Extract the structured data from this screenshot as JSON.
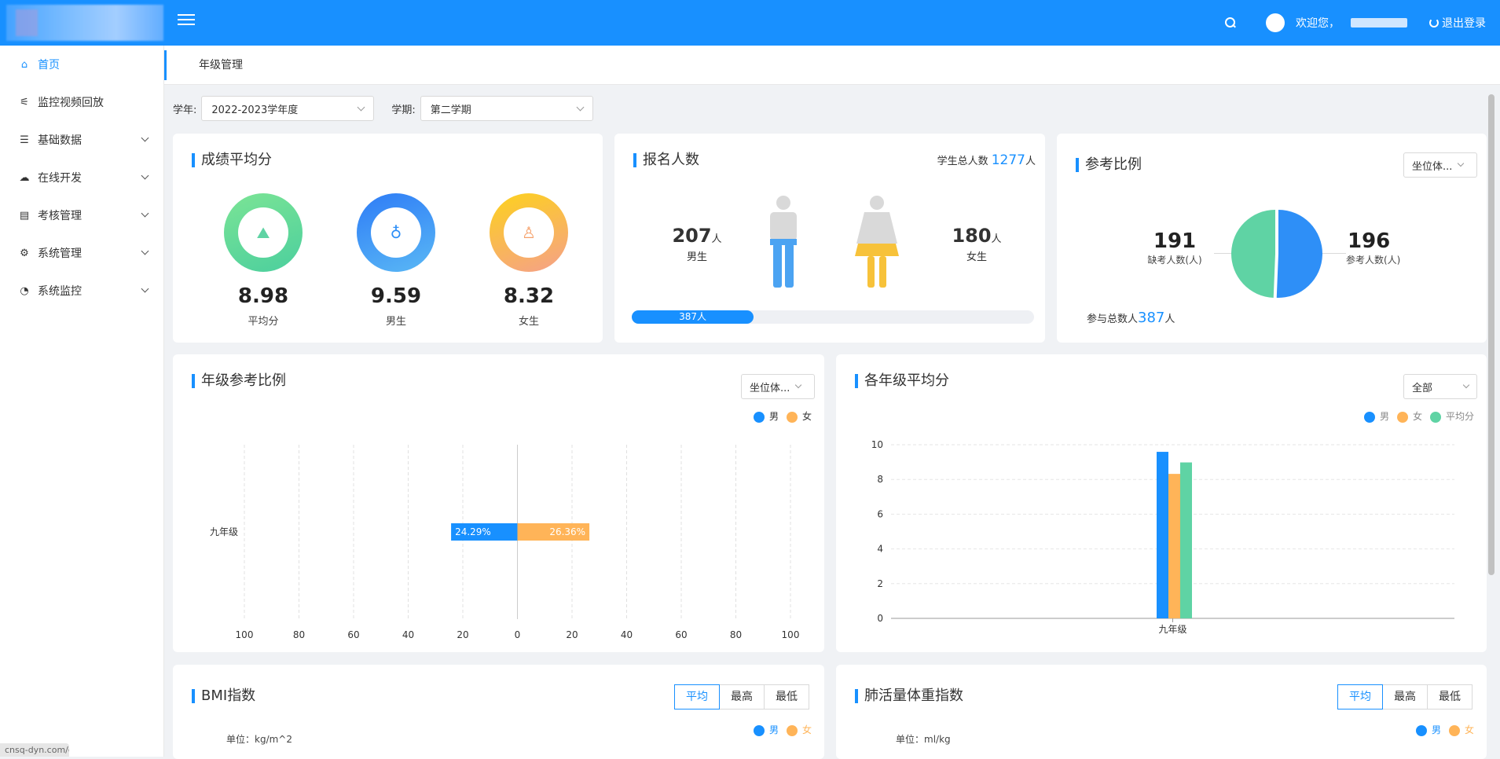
{
  "header": {
    "welcome": "欢迎您，",
    "logout": "退出登录"
  },
  "sidebar": {
    "items": [
      {
        "label": "首页",
        "icon": "home-icon",
        "glyph": "⌂",
        "active": true,
        "expandable": false
      },
      {
        "label": "监控视频回放",
        "icon": "chart-icon",
        "glyph": "⚟",
        "active": false,
        "expandable": false
      },
      {
        "label": "基础数据",
        "icon": "list-icon",
        "glyph": "☰",
        "active": false,
        "expandable": true
      },
      {
        "label": "在线开发",
        "icon": "cloud-icon",
        "glyph": "☁",
        "active": false,
        "expandable": true
      },
      {
        "label": "考核管理",
        "icon": "book-icon",
        "glyph": "▤",
        "active": false,
        "expandable": true
      },
      {
        "label": "系统管理",
        "icon": "gear-icon",
        "glyph": "⚙",
        "active": false,
        "expandable": true
      },
      {
        "label": "系统监控",
        "icon": "dashboard-icon",
        "glyph": "◔",
        "active": false,
        "expandable": true
      }
    ]
  },
  "tabs": {
    "current": "年级管理"
  },
  "filters": {
    "year_label": "学年:",
    "year_value": "2022-2023学年度",
    "term_label": "学期:",
    "term_value": "第二学期"
  },
  "score_card": {
    "title": "成绩平均分",
    "items": [
      {
        "value": "8.98",
        "label": "平均分"
      },
      {
        "value": "9.59",
        "label": "男生"
      },
      {
        "value": "8.32",
        "label": "女生"
      }
    ]
  },
  "signup_card": {
    "title": "报名人数",
    "total_label": "学生总人数",
    "total": "1277",
    "total_unit": "人",
    "male": "207",
    "male_unit": "人",
    "male_label": "男生",
    "female": "180",
    "female_unit": "人",
    "female_label": "女生",
    "progress_text": "387人",
    "progress_ratio": 0.303
  },
  "ratio_card": {
    "title": "参考比例",
    "select": "坐位体...",
    "absent": "191",
    "absent_label": "缺考人数(人)",
    "present": "196",
    "present_label": "参考人数(人)",
    "total_label": "参与总数人",
    "total": "387",
    "total_unit": "人",
    "colors": {
      "absent": "#5fd3a4",
      "present": "#2e8ff7"
    }
  },
  "grade_ratio_card": {
    "title": "年级参考比例",
    "select": "坐位体...",
    "legend": [
      "男",
      "女"
    ]
  },
  "grade_avg_card": {
    "title": "各年级平均分",
    "select": "全部",
    "legend": [
      "男",
      "女",
      "平均分"
    ]
  },
  "bmi_card": {
    "title": "BMI指数",
    "segments": [
      "平均",
      "最高",
      "最低"
    ],
    "unit": "单位：kg/m^2",
    "legend": [
      "男",
      "女"
    ]
  },
  "lung_card": {
    "title": "肺活量体重指数",
    "segments": [
      "平均",
      "最高",
      "最低"
    ],
    "unit": "单位：ml/kg",
    "legend": [
      "男",
      "女"
    ]
  },
  "status_url": "cnsq-dyn.com/c",
  "chart_data": [
    {
      "type": "bar",
      "orientation": "horizontal-diverging",
      "categories": [
        "九年级"
      ],
      "series": [
        {
          "name": "男",
          "values": [
            24.29
          ],
          "labels": [
            "24.29%"
          ],
          "color": "#1890ff"
        },
        {
          "name": "女",
          "values": [
            26.36
          ],
          "labels": [
            "26.36%"
          ],
          "color": "#ffb458"
        }
      ],
      "xticks": [
        "100",
        "80",
        "60",
        "40",
        "20",
        "0",
        "20",
        "40",
        "60",
        "80",
        "100"
      ],
      "xlim": [
        -100,
        100
      ],
      "grid": true,
      "legend": "top-right"
    },
    {
      "type": "bar",
      "categories": [
        "九年级"
      ],
      "series": [
        {
          "name": "男",
          "values": [
            9.59
          ],
          "color": "#1890ff"
        },
        {
          "name": "女",
          "values": [
            8.32
          ],
          "color": "#ffb458"
        },
        {
          "name": "平均分",
          "values": [
            8.98
          ],
          "color": "#5fd3a4"
        }
      ],
      "yticks": [
        "0",
        "2",
        "4",
        "6",
        "8",
        "10"
      ],
      "ylim": [
        0,
        10
      ],
      "grid": true,
      "legend": "top-right"
    }
  ]
}
